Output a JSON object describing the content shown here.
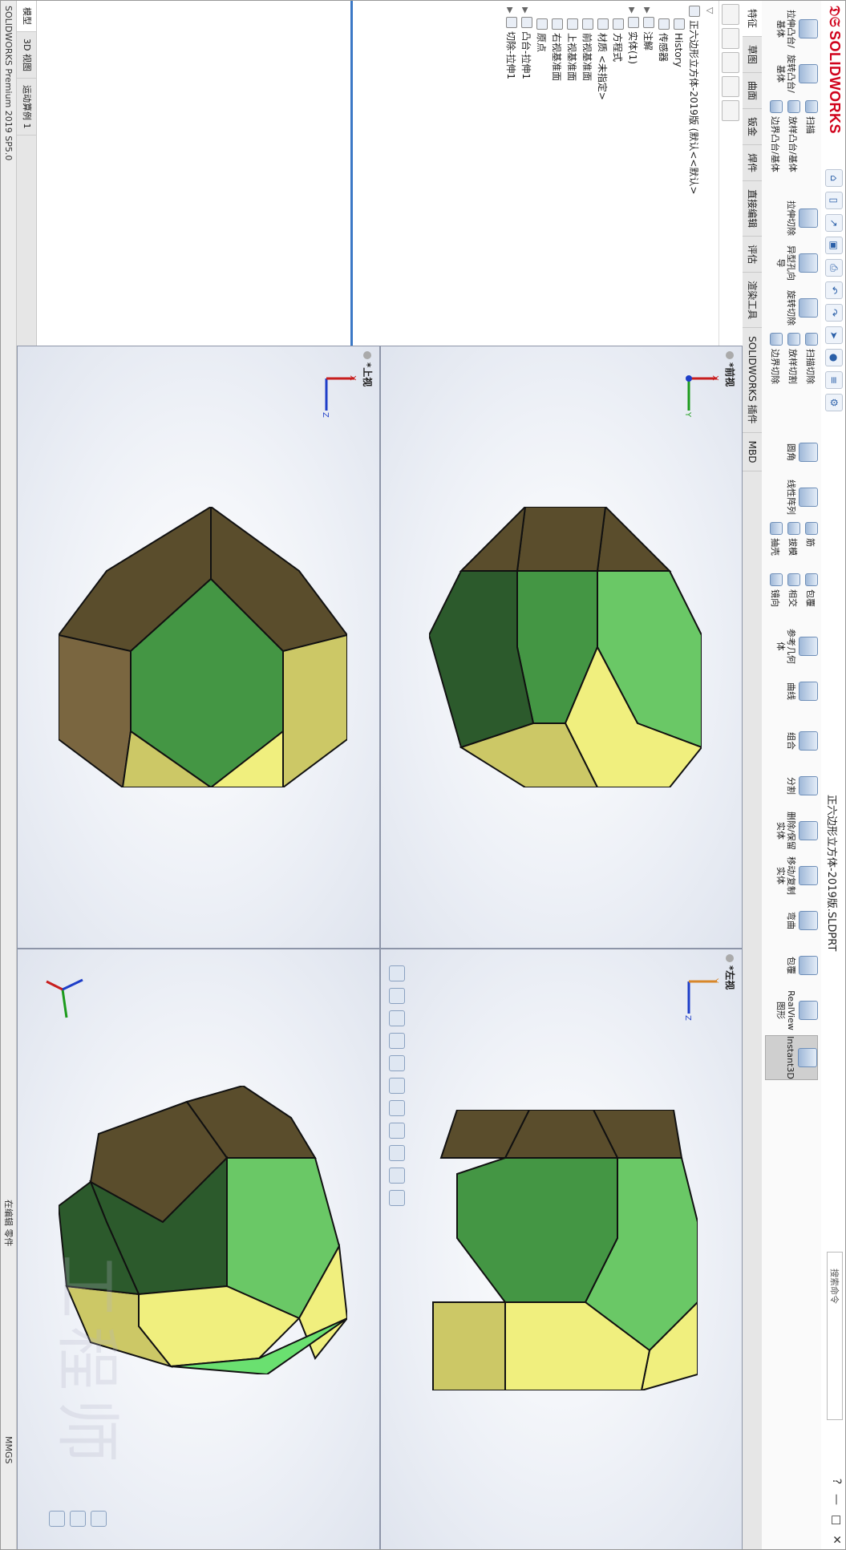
{
  "app": {
    "brand": "SOLIDWORKS",
    "document_title": "正六边形立方体-2019版.SLDPRT",
    "search_placeholder": "搜索命令",
    "window_controls": [
      "?",
      "—",
      "□",
      "✕"
    ]
  },
  "ribbon": {
    "buttons": [
      {
        "label": "拉伸凸台/基体",
        "icon": "extrude-boss-icon"
      },
      {
        "label": "旋转凸台/基体",
        "icon": "revolve-boss-icon"
      },
      {
        "label": "扫描",
        "icon": "sweep-icon"
      },
      {
        "label": "放样凸台/基体",
        "icon": "loft-icon"
      },
      {
        "label": "边界凸台/基体",
        "icon": "boundary-boss-icon"
      },
      {
        "label": "拉伸切除",
        "icon": "extrude-cut-icon"
      },
      {
        "label": "异型孔向导",
        "icon": "hole-wizard-icon"
      },
      {
        "label": "旋转切除",
        "icon": "revolve-cut-icon"
      },
      {
        "label": "扫描切除",
        "icon": "sweep-cut-icon"
      },
      {
        "label": "放样切割",
        "icon": "loft-cut-icon"
      },
      {
        "label": "边界切除",
        "icon": "boundary-cut-icon"
      },
      {
        "label": "圆角",
        "icon": "fillet-icon"
      },
      {
        "label": "线性阵列",
        "icon": "linear-pattern-icon"
      },
      {
        "label": "筋",
        "icon": "rib-icon"
      },
      {
        "label": "拔模",
        "icon": "draft-icon"
      },
      {
        "label": "抽壳",
        "icon": "shell-icon"
      },
      {
        "label": "包覆",
        "icon": "wrap-icon"
      },
      {
        "label": "相交",
        "icon": "intersect-icon"
      },
      {
        "label": "镜向",
        "icon": "mirror-icon"
      },
      {
        "label": "参考几何体",
        "icon": "reference-geometry-icon"
      },
      {
        "label": "曲线",
        "icon": "curves-icon"
      },
      {
        "label": "组合",
        "icon": "combine-icon"
      },
      {
        "label": "分割",
        "icon": "split-icon"
      },
      {
        "label": "删除/保留实体",
        "icon": "delete-body-icon"
      },
      {
        "label": "移动/复制实体",
        "icon": "move-copy-body-icon"
      },
      {
        "label": "弯曲",
        "icon": "flex-icon"
      },
      {
        "label": "包覆",
        "icon": "wrap2-icon"
      },
      {
        "label": "RealView 图形",
        "icon": "realview-icon"
      },
      {
        "label": "Instant3D",
        "icon": "instant3d-icon"
      }
    ]
  },
  "tabs": [
    "特征",
    "草图",
    "曲面",
    "钣金",
    "焊件",
    "直接编辑",
    "评估",
    "渲染工具",
    "SOLIDWORKS 插件",
    "MBD"
  ],
  "feature_tree": {
    "root": "正六边形立方体-2019版 (默认<<默认>",
    "items": [
      "History",
      "传感器",
      "注解",
      "实体(1)",
      "方程式",
      "材质 <未指定>",
      "前视基准面",
      "上视基准面",
      "右视基准面",
      "原点",
      "凸台-拉伸1",
      "切除-拉伸1"
    ]
  },
  "bottom_tabs": [
    "模型",
    "3D 视图",
    "运动算例 1"
  ],
  "views": {
    "front": "*前视",
    "top": "*上视",
    "left": "*左视",
    "iso": ""
  },
  "triad_labels": {
    "x": "X",
    "y": "Y",
    "z": "Z"
  },
  "colors": {
    "green_light": "#6ac866",
    "green_mid": "#449644",
    "green_dark": "#2c5a2c",
    "yellow": "#f0ef7e",
    "olive": "#ccc866",
    "brown": "#5a4d2c",
    "brown_mid": "#7a6640"
  },
  "status": {
    "product": "SOLIDWORKS Premium 2019 SP5.0",
    "mode": "在编辑 零件",
    "units": "MMGS"
  },
  "watermark": "工程师"
}
